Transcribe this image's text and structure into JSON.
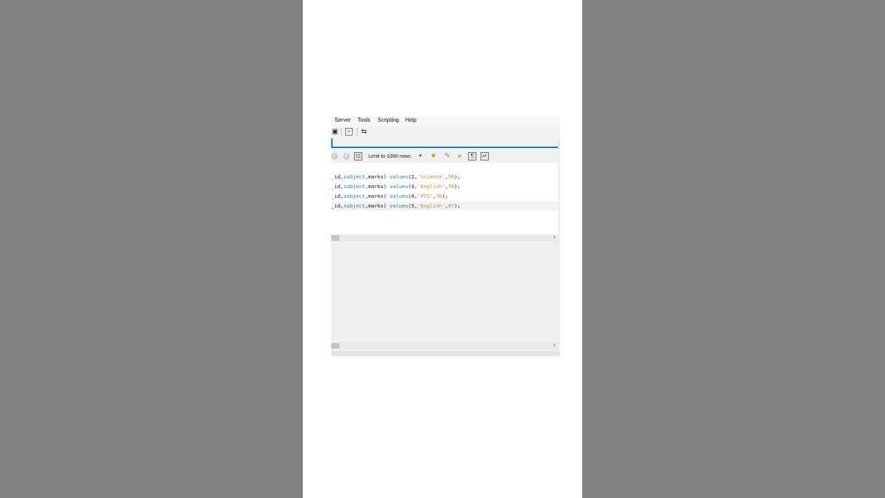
{
  "menu": {
    "items": [
      "Server",
      "Tools",
      "Scripting",
      "Help"
    ]
  },
  "main_toolbar": {
    "icons": [
      "script-icon",
      "inspector-icon",
      "reconnect-icon"
    ]
  },
  "sql_toolbar": {
    "limit_label": "Limit to 1000 rows",
    "icons": [
      "commit-icon",
      "rollback-icon",
      "autocommit-toggle-icon",
      "bookmark-star-icon",
      "beautify-broom-icon",
      "find-icon",
      "invisible-chars-icon",
      "word-wrap-icon"
    ]
  },
  "editor": {
    "lines": [
      {
        "prefix": "_id,",
        "col": "subject",
        "rest": ",marks) ",
        "kw": "values",
        "open": "(2,",
        "str": "'Science'",
        "num_sep": ",",
        "num": "56",
        "close": ");"
      },
      {
        "prefix": "_id,",
        "col": "subject",
        "rest": ",marks) ",
        "kw": "values",
        "open": "(3,",
        "str": "'English'",
        "num_sep": ",",
        "num": "78",
        "close": ");"
      },
      {
        "prefix": "_id,",
        "col": "subject",
        "rest": ",marks) ",
        "kw": "values",
        "open": "(4,",
        "str": "'PTS'",
        "num_sep": ",",
        "num": "78",
        "close": ");"
      },
      {
        "prefix": "_id,",
        "col": "subject",
        "rest": ",marks) ",
        "kw": "values",
        "open": "(5,",
        "str": "'English'",
        "num_sep": ",",
        "num": "87",
        "close": ");"
      }
    ]
  },
  "scroll": {
    "arrow": "›"
  },
  "colors": {
    "accent": "#0a7bc4",
    "keyword": "#1c7ca8",
    "string": "#c98a2d"
  }
}
